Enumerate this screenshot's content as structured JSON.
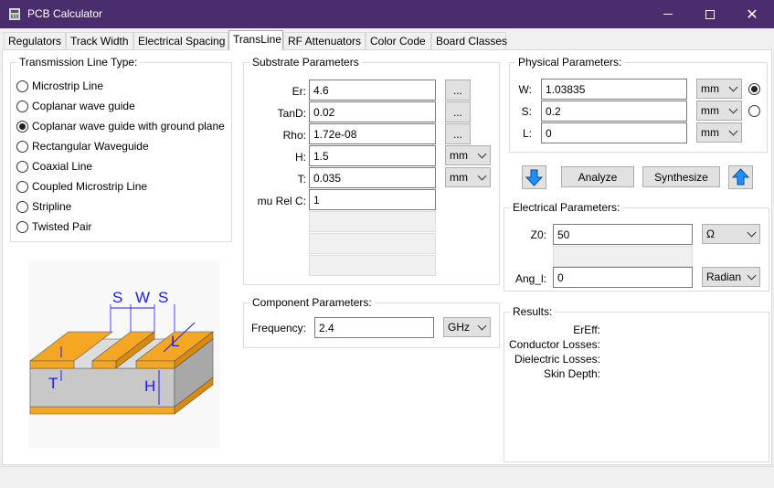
{
  "window": {
    "title": "PCB Calculator",
    "minimize": "—",
    "close": "✕"
  },
  "tabs": [
    {
      "label": "Regulators"
    },
    {
      "label": "Track Width"
    },
    {
      "label": "Electrical Spacing"
    },
    {
      "label": "TransLine"
    },
    {
      "label": "RF Attenuators"
    },
    {
      "label": "Color Code"
    },
    {
      "label": "Board Classes"
    }
  ],
  "line_type": {
    "label": "Transmission Line Type:",
    "options": [
      {
        "label": "Microstrip Line",
        "checked": false
      },
      {
        "label": "Coplanar wave guide",
        "checked": false
      },
      {
        "label": "Coplanar wave guide with ground plane",
        "checked": true
      },
      {
        "label": "Rectangular Waveguide",
        "checked": false
      },
      {
        "label": "Coaxial Line",
        "checked": false
      },
      {
        "label": "Coupled Microstrip Line",
        "checked": false
      },
      {
        "label": "Stripline",
        "checked": false
      },
      {
        "label": "Twisted Pair",
        "checked": false
      }
    ]
  },
  "diagram": {
    "s1": "S",
    "w": "W",
    "s2": "S",
    "l": "L",
    "t": "T",
    "h": "H"
  },
  "substrate": {
    "label": "Substrate Parameters",
    "er": {
      "label": "Er:",
      "value": "4.6",
      "btn": "..."
    },
    "tand": {
      "label": "TanD:",
      "value": "0.02",
      "btn": "..."
    },
    "rho": {
      "label": "Rho:",
      "value": "1.72e-08",
      "btn": "..."
    },
    "h": {
      "label": "H:",
      "value": "1.5",
      "unit": "mm"
    },
    "t": {
      "label": "T:",
      "value": "0.035",
      "unit": "mm"
    },
    "murel": {
      "label": "mu Rel C:",
      "value": "1"
    }
  },
  "component": {
    "label": "Component Parameters:",
    "freq": {
      "label": "Frequency:",
      "value": "2.4",
      "unit": "GHz"
    }
  },
  "physical": {
    "label": "Physical Parameters:",
    "w": {
      "label": "W:",
      "value": "1.03835",
      "unit": "mm"
    },
    "s": {
      "label": "S:",
      "value": "0.2",
      "unit": "mm"
    },
    "l": {
      "label": "L:",
      "value": "0",
      "unit": "mm"
    }
  },
  "actions": {
    "analyze": "Analyze",
    "synthesize": "Synthesize"
  },
  "electrical": {
    "label": "Electrical Parameters:",
    "z0": {
      "label": "Z0:",
      "value": "50",
      "unit": "Ω"
    },
    "ang": {
      "label": "Ang_l:",
      "value": "0",
      "unit": "Radian"
    }
  },
  "results": {
    "label": "Results:",
    "items": [
      {
        "label": "ErEff:"
      },
      {
        "label": "Conductor Losses:"
      },
      {
        "label": "Dielectric Losses:"
      },
      {
        "label": "Skin Depth:"
      }
    ]
  },
  "colors": {
    "titlebar": "#4a2d6d",
    "copper": "#f5a623",
    "substrate": "#c8c8c8",
    "dim": "#1a1aff",
    "arrow": "#1e90ff"
  }
}
